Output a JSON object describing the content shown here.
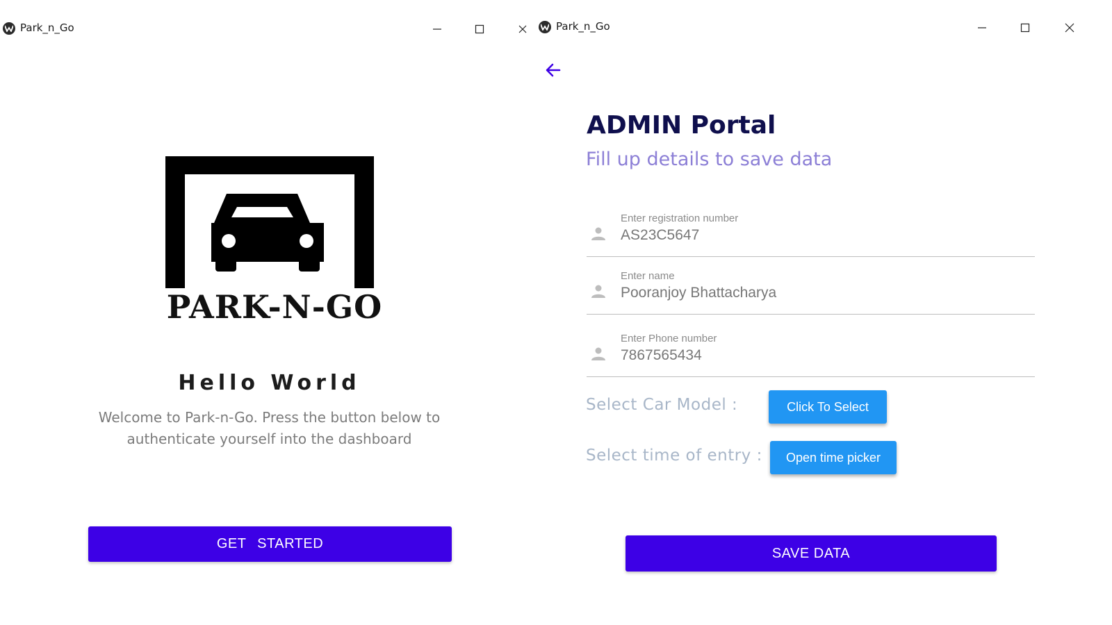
{
  "left_window": {
    "title": "Park_n_Go",
    "logo_text": "PARK-N-GO",
    "heading": "Hello World",
    "welcome_text": "Welcome to Park-n-Go. Press the button below to authenticate yourself into the dashboard",
    "get_started_label": "GET STARTED"
  },
  "right_window": {
    "title": "Park_n_Go",
    "page_title": "ADMIN Portal",
    "subtitle": "Fill up details to save data",
    "fields": {
      "registration": {
        "label": "Enter registration number",
        "value": "AS23C5647"
      },
      "name": {
        "label": "Enter name",
        "value": "Pooranjoy Bhattacharya"
      },
      "phone": {
        "label": "Enter Phone number",
        "value": "7867565434"
      }
    },
    "car_model_label": "Select Car Model :",
    "car_model_button": "Click To Select",
    "time_label": "Select time of entry :",
    "time_button": "Open time picker",
    "save_label": "SAVE DATA"
  },
  "colors": {
    "primary": "#3d00e6",
    "button_blue": "#2196f3",
    "title_dark": "#0f0f4d",
    "subtitle_purple": "#8c7fd6",
    "muted_label": "#a8b6c8"
  },
  "icons": {
    "app": "app-logo-icon",
    "minimize": "minimize-icon",
    "maximize": "maximize-icon",
    "close": "close-icon",
    "back": "arrow-back-icon",
    "person": "person-icon",
    "logo": "garage-car-icon"
  }
}
